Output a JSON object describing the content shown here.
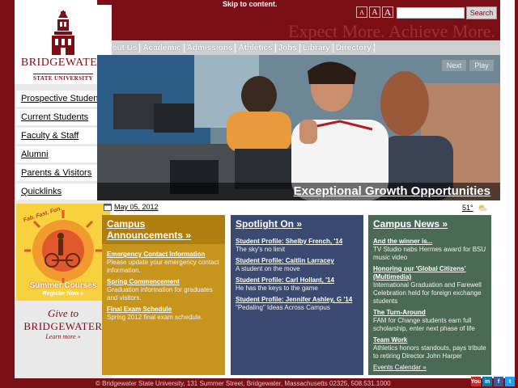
{
  "header": {
    "skip_link": "Skip to content.",
    "font_sizes": [
      "A",
      "A",
      "A"
    ],
    "search_placeholder": "",
    "search_button": "Search",
    "slogan": "Expect More. Achieve More."
  },
  "logo": {
    "name": "BRIDGEWATER",
    "sub": "STATE UNIVERSITY"
  },
  "main_nav": [
    "About Us",
    "Academic",
    "Admissions",
    "Athletics",
    "Jobs",
    "Library",
    "Directory"
  ],
  "left_nav": [
    {
      "label": "Prospective Students"
    },
    {
      "label": "Current Students"
    },
    {
      "label": "Faculty & Staff"
    },
    {
      "label": "Alumni"
    },
    {
      "label": "Parents & Visitors"
    },
    {
      "label": "Quicklinks",
      "arrow": "»"
    }
  ],
  "promo": {
    "tagline": "Fab. Fast. Fun.",
    "title": "Summer Courses",
    "cta": "Register Now »"
  },
  "give": {
    "line1": "Give to",
    "line2": "BRIDGEWATER",
    "line3": "Learn more »"
  },
  "hero": {
    "next": "Next",
    "play": "Play",
    "caption": "Exceptional Growth Opportunities"
  },
  "date": "May 05, 2012",
  "weather": "51°",
  "announcements": {
    "title": "Campus Announcements »",
    "items": [
      {
        "title": "Emergency Contact Information",
        "body": "Please update your emergency contact information."
      },
      {
        "title": "Spring Commencement",
        "body": "Graduation information for graduates and visitors."
      },
      {
        "title": "Final Exam Schedule",
        "body": "Spring 2012 final exam schedule."
      }
    ]
  },
  "spotlight": {
    "title": "Spotlight On »",
    "items": [
      {
        "title": "Student Profile: Shelby French, '14",
        "body": "The sky's no limit"
      },
      {
        "title": "Student Profile: Caitlin Larracey",
        "body": "A student on the move"
      },
      {
        "title": "Student Profile: Carl Hollant, '14",
        "body": "He has the keys to the game"
      },
      {
        "title": "Student Profile: Jennifer Ashley, G '14",
        "body": "\"Pedaling\" Ideas Across Campus"
      }
    ]
  },
  "news": {
    "title": "Campus News »",
    "items": [
      {
        "title": "And the winner is...",
        "body": "TV Studio nabs Hermes award for BSU music video"
      },
      {
        "title": "Honoring our 'Global Citizens' (Multimedia)",
        "body": "International Graduation and Farewell Celebration held for foreign exchange students"
      },
      {
        "title": "The Turn-Around",
        "body": "FAM for Change students earn full scholarship, enter next phase of life"
      },
      {
        "title": "Team Work",
        "body": "Athletics honors standouts, pays tribute to retiring Director John Harper"
      }
    ],
    "more": "Events Calendar »"
  },
  "footer": {
    "address": "© Bridgewater State University, 131 Summer Street, Bridgewater, Massachusetts 02325, 508.531.1000"
  },
  "social": [
    {
      "name": "youtube",
      "label": "You",
      "color": "#c4302b"
    },
    {
      "name": "linkedin",
      "label": "in",
      "color": "#0e76a8"
    },
    {
      "name": "facebook",
      "label": "f",
      "color": "#3b5998"
    },
    {
      "name": "twitter",
      "label": "t",
      "color": "#1da1f2"
    }
  ],
  "colors": {
    "brand": "#7a0f16",
    "gold": "#c8951c",
    "navy": "#3b4a70",
    "green": "#4a6a55"
  }
}
